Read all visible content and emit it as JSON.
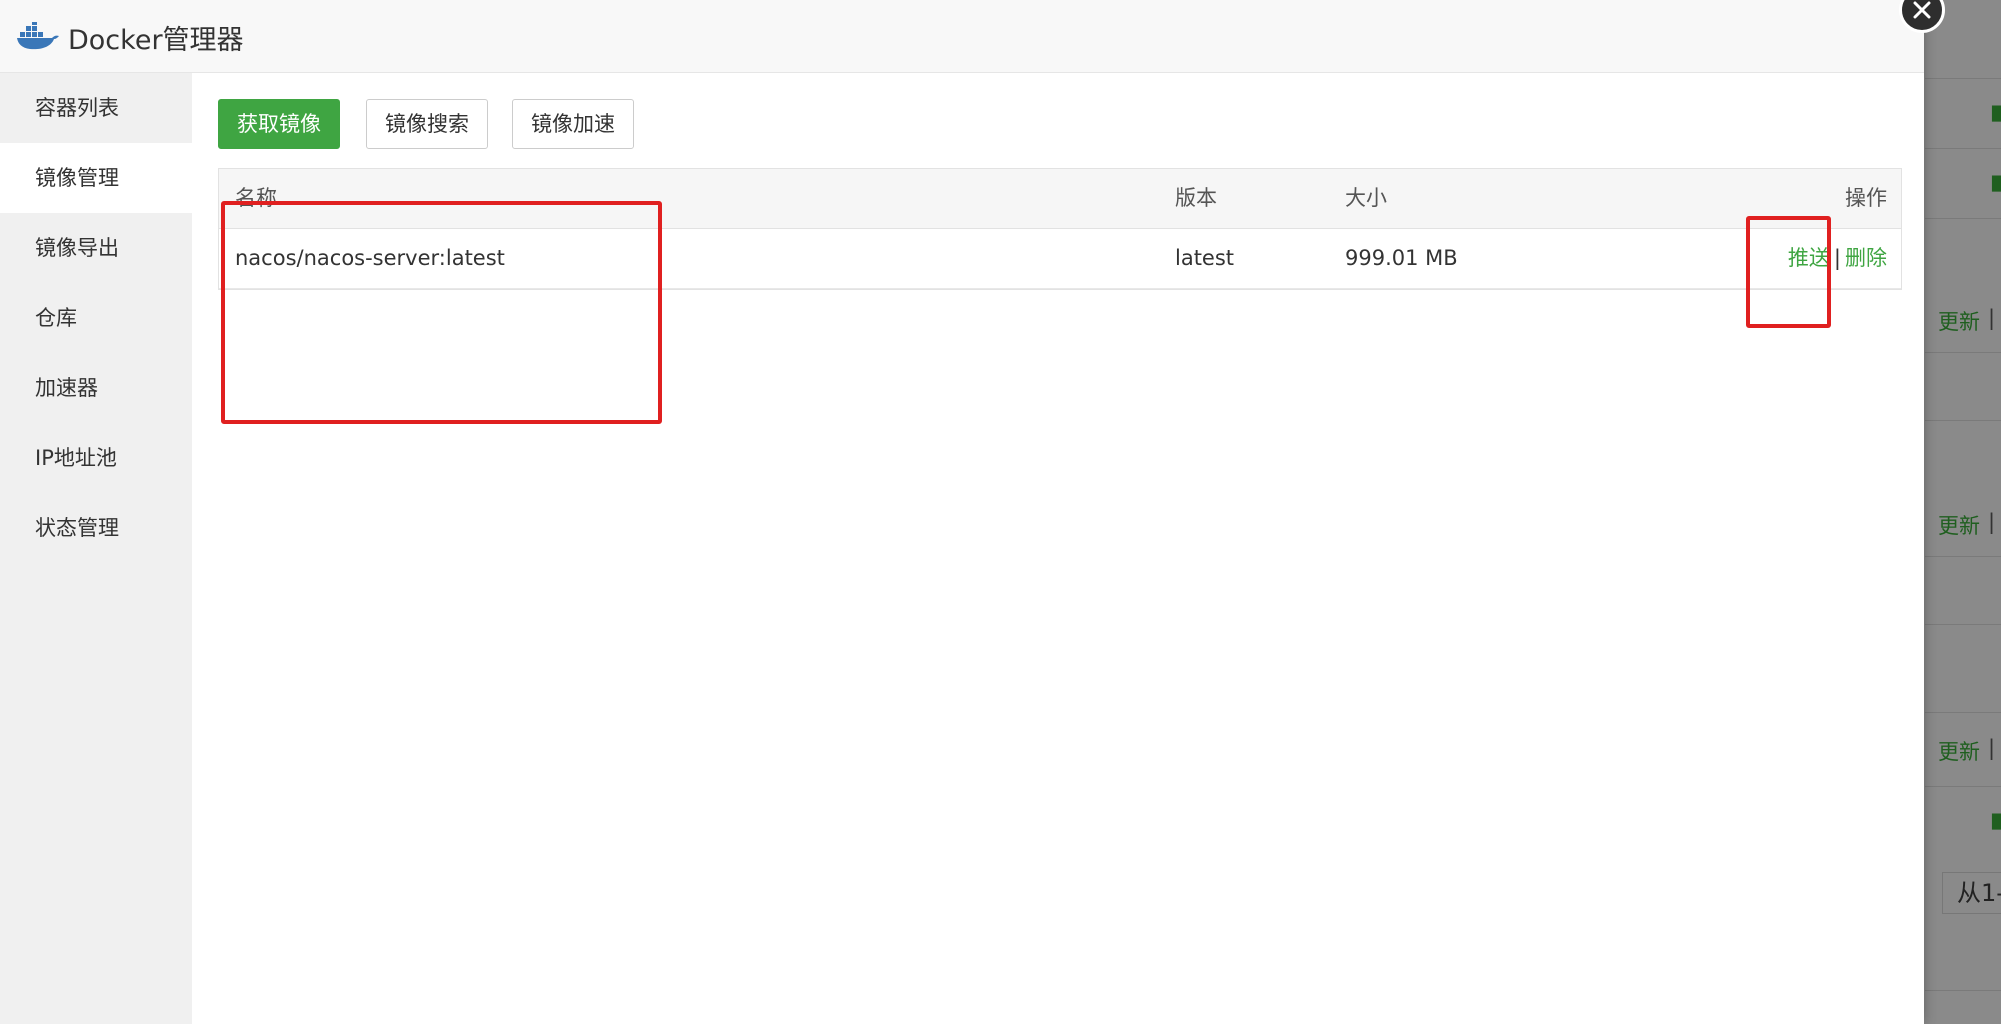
{
  "modal": {
    "title": "Docker管理器",
    "icon": "docker-whale-icon"
  },
  "sidebar": {
    "items": [
      {
        "label": "容器列表",
        "active": false
      },
      {
        "label": "镜像管理",
        "active": true
      },
      {
        "label": "镜像导出",
        "active": false
      },
      {
        "label": "仓库",
        "active": false
      },
      {
        "label": "加速器",
        "active": false
      },
      {
        "label": "IP地址池",
        "active": false
      },
      {
        "label": "状态管理",
        "active": false
      }
    ]
  },
  "toolbar": {
    "pull_label": "获取镜像",
    "search_label": "镜像搜索",
    "accelerate_label": "镜像加速"
  },
  "table": {
    "headers": {
      "name": "名称",
      "version": "版本",
      "size": "大小",
      "ops": "操作"
    },
    "rows": [
      {
        "name": "nacos/nacos-server:latest",
        "version": "latest",
        "size": "999.01 MB",
        "push": "推送",
        "sep": "|",
        "delete": "删除"
      }
    ]
  },
  "background": {
    "links": [
      "更新",
      "更新",
      "更新"
    ],
    "sep": "|",
    "pager_text": "从1-"
  },
  "colors": {
    "accent_green": "#3fa542",
    "annotation_red": "#e02020",
    "header_bg": "#f8f8f8",
    "sidebar_bg": "#f0f0f0"
  }
}
